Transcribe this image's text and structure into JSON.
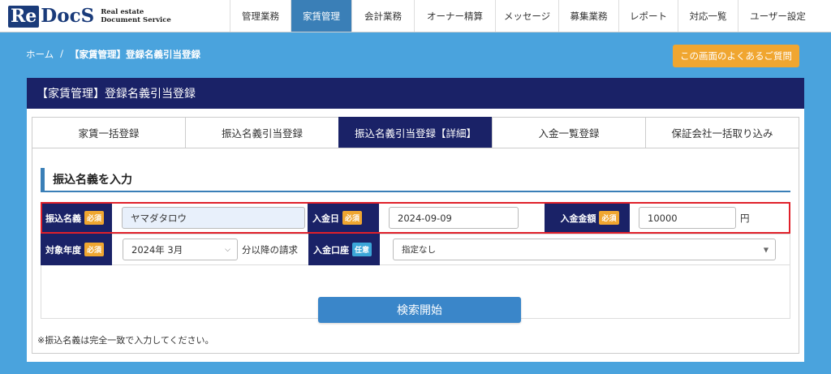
{
  "logo": {
    "mark_re": "Re",
    "mark_docs": "DocS",
    "sub_line1": "Real estate",
    "sub_line2": "Document Service"
  },
  "nav": [
    {
      "label": "管理業務",
      "width": 75
    },
    {
      "label": "家賃管理",
      "width": 75,
      "active": true
    },
    {
      "label": "会計業務",
      "width": 77
    },
    {
      "label": "オーナー精算",
      "width": 100
    },
    {
      "label": "メッセージ",
      "width": 78
    },
    {
      "label": "募集業務",
      "width": 74
    },
    {
      "label": "レポート",
      "width": 73
    },
    {
      "label": "対応一覧",
      "width": 74
    },
    {
      "label": "ユーザー設定",
      "width": 98
    }
  ],
  "breadcrumb": {
    "home": "ホーム",
    "sep": "/",
    "current": "【家賃管理】登録名義引当登録"
  },
  "faq_button": "この画面のよくあるご質問",
  "panel": {
    "title": "【家賃管理】登録名義引当登録"
  },
  "tabs": [
    {
      "label": "家賃一括登録"
    },
    {
      "label": "振込名義引当登録"
    },
    {
      "label": "振込名義引当登録【詳細】",
      "active": true
    },
    {
      "label": "入金一覧登録"
    },
    {
      "label": "保証会社一括取り込み"
    }
  ],
  "section_title": "振込名義を入力",
  "form": {
    "row1": {
      "name_label": "振込名義",
      "name_badge": "必須",
      "name_value": "ヤマダタロウ",
      "date_label": "入金日",
      "date_badge": "必須",
      "date_value": "2024-09-09",
      "amount_label": "入金金額",
      "amount_badge": "必須",
      "amount_value": "10000",
      "amount_unit": "円"
    },
    "row2": {
      "year_label": "対象年度",
      "year_badge": "必須",
      "year_value": "2024年 3月",
      "year_suffix": "分以降の請求",
      "account_label": "入金口座",
      "account_badge": "任意",
      "account_value": "指定なし"
    }
  },
  "search_button": "検索開始",
  "note": "※振込名義は完全一致で入力してください。",
  "colors": {
    "navy": "#1a2267",
    "accent_blue": "#3a7fb7",
    "required_badge": "#f0a630",
    "optional_badge": "#3ba6d8",
    "highlight_red": "#e0202a",
    "background": "#4aa3dd"
  }
}
